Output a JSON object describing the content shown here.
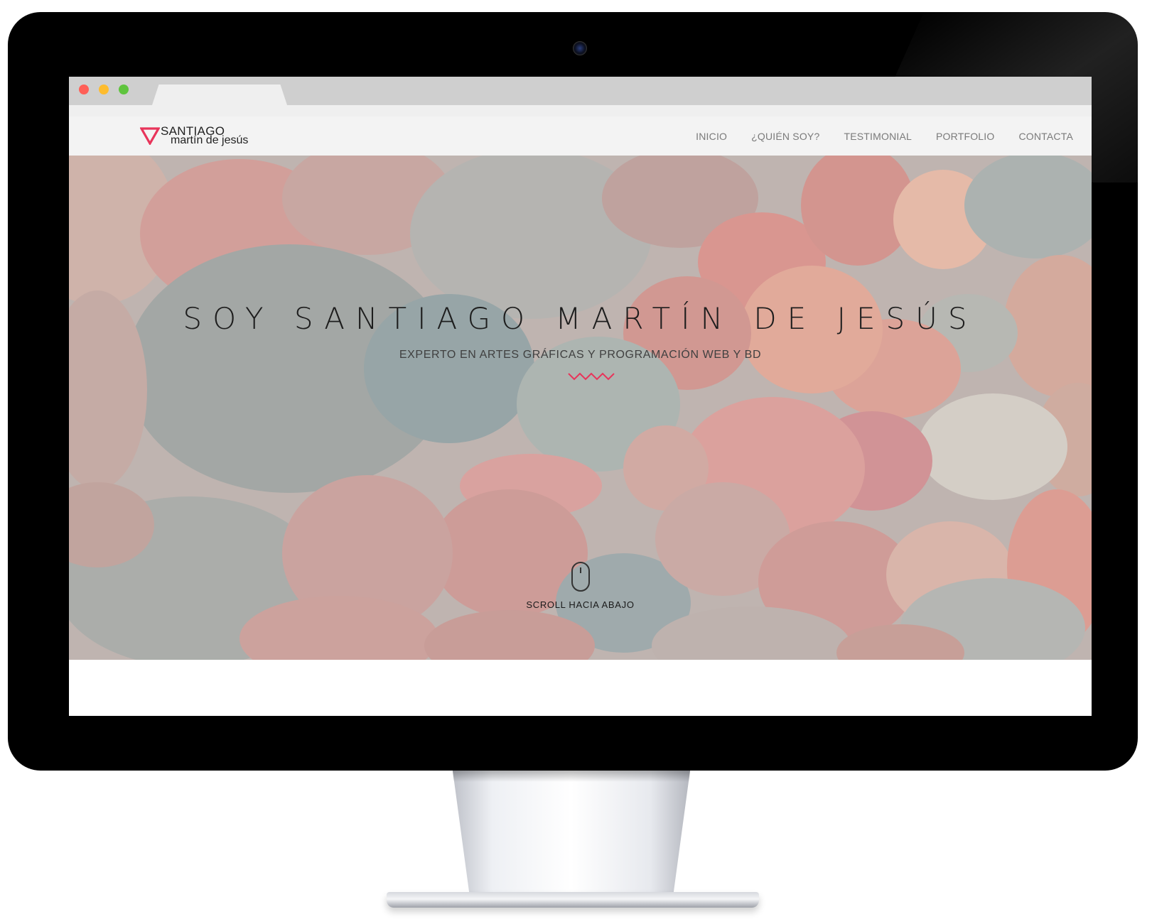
{
  "site": {
    "logo": {
      "line1": "SANTIAGO",
      "line2": "martín de jesús",
      "mark_icon": "red-triangle-logo",
      "accent_color": "#e8345a"
    },
    "nav": {
      "items": [
        {
          "label": "INICIO"
        },
        {
          "label": "¿QUIÉN SOY?"
        },
        {
          "label": "TESTIMONIAL"
        },
        {
          "label": "PORTFOLIO"
        },
        {
          "label": "CONTACTA"
        }
      ]
    },
    "hero": {
      "title": "SOY SANTIAGO MARTÍN DE JESÚS",
      "subtitle": "EXPERTO EN ARTES GRÁFICAS Y PROGRAMACIÓN WEB Y BD",
      "divider_icon": "zigzag-divider",
      "scroll_icon": "mouse-icon",
      "scroll_label": "SCROLL HACIA ABAJO",
      "background_icon": "river-stones-photo"
    }
  },
  "browser": {
    "window_controls": [
      "close",
      "minimize",
      "maximize"
    ],
    "control_colors": [
      "#ff5f57",
      "#febc2e",
      "#5fc43e"
    ]
  },
  "device": {
    "type": "desktop-monitor",
    "icons": [
      "webcam-icon",
      "monitor-stand"
    ]
  }
}
